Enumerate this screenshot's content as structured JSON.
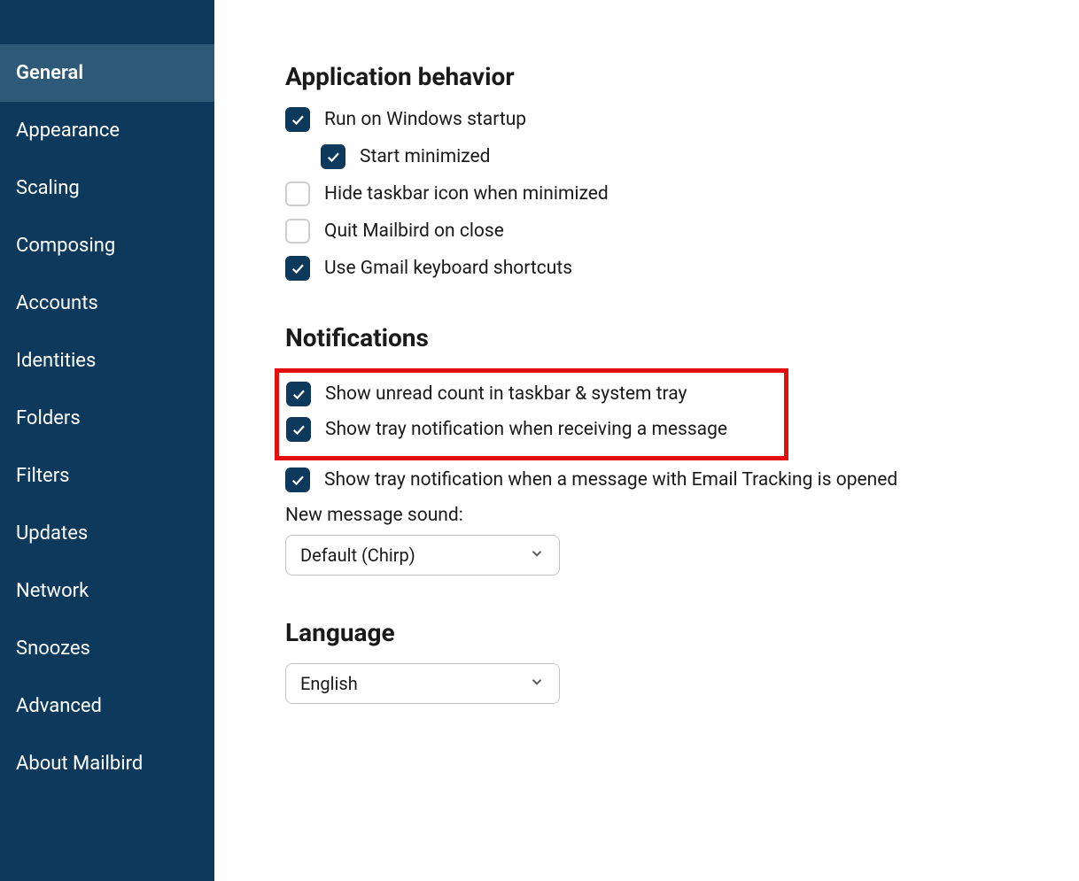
{
  "sidebar": {
    "items": [
      {
        "label": "General",
        "active": true
      },
      {
        "label": "Appearance",
        "active": false
      },
      {
        "label": "Scaling",
        "active": false
      },
      {
        "label": "Composing",
        "active": false
      },
      {
        "label": "Accounts",
        "active": false
      },
      {
        "label": "Identities",
        "active": false
      },
      {
        "label": "Folders",
        "active": false
      },
      {
        "label": "Filters",
        "active": false
      },
      {
        "label": "Updates",
        "active": false
      },
      {
        "label": "Network",
        "active": false
      },
      {
        "label": "Snoozes",
        "active": false
      },
      {
        "label": "Advanced",
        "active": false
      },
      {
        "label": "About Mailbird",
        "active": false
      }
    ]
  },
  "sections": {
    "app_behavior": {
      "title": "Application behavior",
      "options": [
        {
          "label": "Run on Windows startup",
          "checked": true,
          "indent": false
        },
        {
          "label": "Start minimized",
          "checked": true,
          "indent": true
        },
        {
          "label": "Hide taskbar icon when minimized",
          "checked": false,
          "indent": false
        },
        {
          "label": "Quit Mailbird on close",
          "checked": false,
          "indent": false
        },
        {
          "label": "Use Gmail keyboard shortcuts",
          "checked": true,
          "indent": false
        }
      ]
    },
    "notifications": {
      "title": "Notifications",
      "highlighted": [
        {
          "label": "Show unread count in taskbar & system tray",
          "checked": true
        },
        {
          "label": "Show tray notification when receiving a message",
          "checked": true
        }
      ],
      "rest": [
        {
          "label": "Show tray notification when a message with Email Tracking is opened",
          "checked": true
        }
      ],
      "sound_label": "New message sound:",
      "sound_value": "Default (Chirp)"
    },
    "language": {
      "title": "Language",
      "value": "English"
    }
  }
}
